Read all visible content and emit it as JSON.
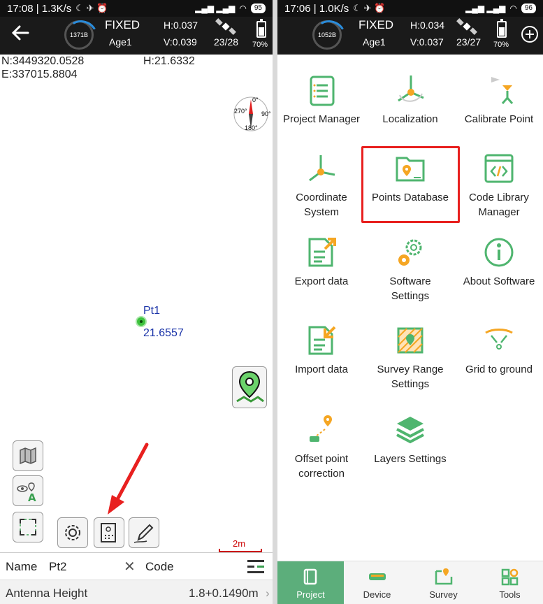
{
  "left": {
    "status": {
      "time_speed": "17:08 | 1.3K/s",
      "battery": "95"
    },
    "gnss": {
      "ring_label": "1371B",
      "solution": "FIXED",
      "age": "Age1",
      "h": "H:0.037",
      "v": "V:0.039",
      "sats": "23/28",
      "phone_batt": "70%"
    },
    "coords": {
      "n": "N:3449320.0528",
      "e": "E:337015.8804",
      "h": "H:21.6332"
    },
    "compass": {
      "n": "0°",
      "e": "90°",
      "s": "180°",
      "w": "270°"
    },
    "point": {
      "name": "Pt1",
      "elev": "21.6557"
    },
    "scale": "2m",
    "name_row": {
      "label": "Name",
      "value": "Pt2",
      "clear": "✕",
      "code_label": "Code"
    },
    "antenna": {
      "label": "Antenna Height",
      "value": "1.8+0.1490m"
    }
  },
  "right": {
    "status": {
      "time_speed": "17:06 | 1.0K/s",
      "battery": "96"
    },
    "gnss": {
      "ring_label": "1052B",
      "solution": "FIXED",
      "age": "Age1",
      "h": "H:0.034",
      "v": "V:0.037",
      "sats": "23/27",
      "phone_batt": "70%"
    },
    "menu": [
      {
        "label": "Project Manager",
        "icon": "project-manager-icon"
      },
      {
        "label": "Localization",
        "icon": "localization-icon"
      },
      {
        "label": "Calibrate Point",
        "icon": "calibrate-point-icon"
      },
      {
        "label": "Coordinate\nSystem",
        "icon": "coordinate-system-icon"
      },
      {
        "label": "Points Database",
        "icon": "points-database-icon"
      },
      {
        "label": "Code Library\nManager",
        "icon": "code-library-icon"
      },
      {
        "label": "Export data",
        "icon": "export-data-icon"
      },
      {
        "label": "Software\nSettings",
        "icon": "software-settings-icon"
      },
      {
        "label": "About Software",
        "icon": "about-software-icon"
      },
      {
        "label": "Import data",
        "icon": "import-data-icon"
      },
      {
        "label": "Survey Range\nSettings",
        "icon": "survey-range-icon"
      },
      {
        "label": "Grid to ground",
        "icon": "grid-to-ground-icon"
      },
      {
        "label": "Offset point\ncorrection",
        "icon": "offset-point-icon"
      },
      {
        "label": "Layers Settings",
        "icon": "layers-settings-icon"
      }
    ],
    "nav": [
      {
        "label": "Project",
        "active": true
      },
      {
        "label": "Device",
        "active": false
      },
      {
        "label": "Survey",
        "active": false
      },
      {
        "label": "Tools",
        "active": false
      }
    ]
  },
  "colors": {
    "accent_green": "#5cae7b",
    "highlight_red": "#e8201f",
    "point_label": "#1a33a8",
    "icon_green": "#4fb56f",
    "icon_orange": "#f5a623"
  }
}
